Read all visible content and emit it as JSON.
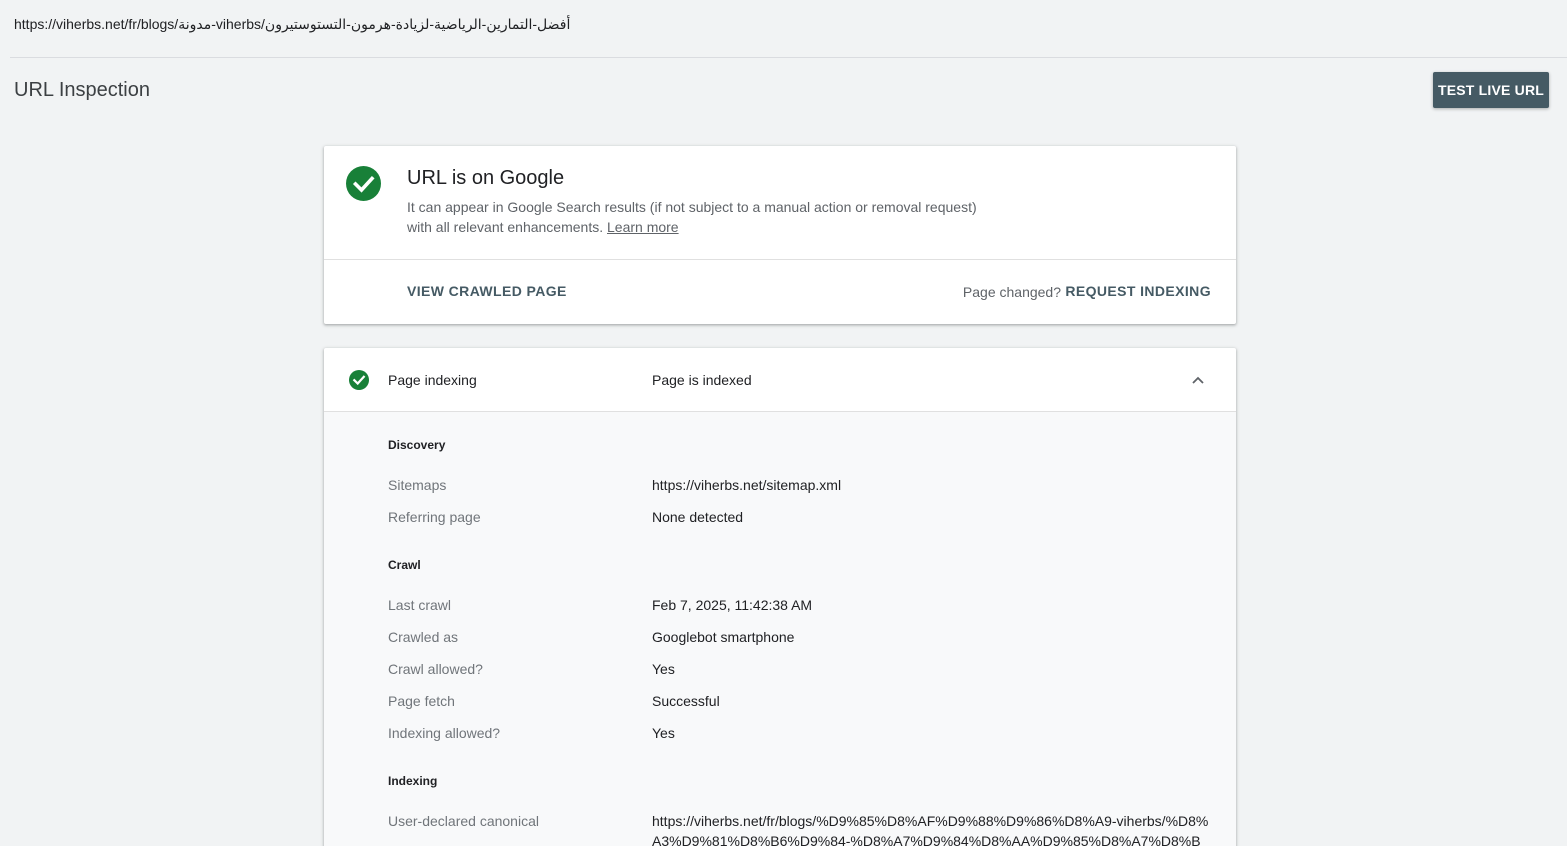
{
  "url_bar": {
    "url": "https://viherbs.net/fr/blogs/مدونة-viherbs/أفضل-التمارين-الرياضية-لزيادة-هرمون-التستوستيرون"
  },
  "header": {
    "title": "URL Inspection",
    "test_live_url_label": "TEST LIVE URL"
  },
  "status_card": {
    "icon": "check-circle-icon",
    "title": "URL is on Google",
    "description": "It can appear in Google Search results (if not subject to a manual action or removal request) with all relevant enhancements.",
    "learn_more": "Learn more",
    "view_crawled_page": "VIEW CRAWLED PAGE",
    "page_changed": "Page changed?",
    "request_indexing": "REQUEST INDEXING"
  },
  "page_indexing": {
    "icon": "check-circle-icon",
    "title": "Page indexing",
    "status": "Page is indexed",
    "toggle_icon": "chevron-up-icon",
    "discovery": {
      "heading": "Discovery",
      "rows": [
        {
          "label": "Sitemaps",
          "value": "https://viherbs.net/sitemap.xml"
        },
        {
          "label": "Referring page",
          "value": "None detected"
        }
      ]
    },
    "crawl": {
      "heading": "Crawl",
      "rows": [
        {
          "label": "Last crawl",
          "value": "Feb 7, 2025, 11:42:38 AM"
        },
        {
          "label": "Crawled as",
          "value": "Googlebot smartphone"
        },
        {
          "label": "Crawl allowed?",
          "value": "Yes"
        },
        {
          "label": "Page fetch",
          "value": "Successful"
        },
        {
          "label": "Indexing allowed?",
          "value": "Yes"
        }
      ]
    },
    "indexing": {
      "heading": "Indexing",
      "rows": [
        {
          "label": "User-declared canonical",
          "value": "https://viherbs.net/fr/blogs/%D9%85%D8%AF%D9%88%D9%86%D8%A9-viherbs/%D8%A3%D9%81%D8%B6%D9%84-%D8%A7%D9%84%D8%AA%D9%85%D8%A7%D8%B"
        }
      ]
    }
  },
  "colors": {
    "accent_green": "#188038",
    "button_dark": "#455a64",
    "background": "#f1f3f4"
  }
}
